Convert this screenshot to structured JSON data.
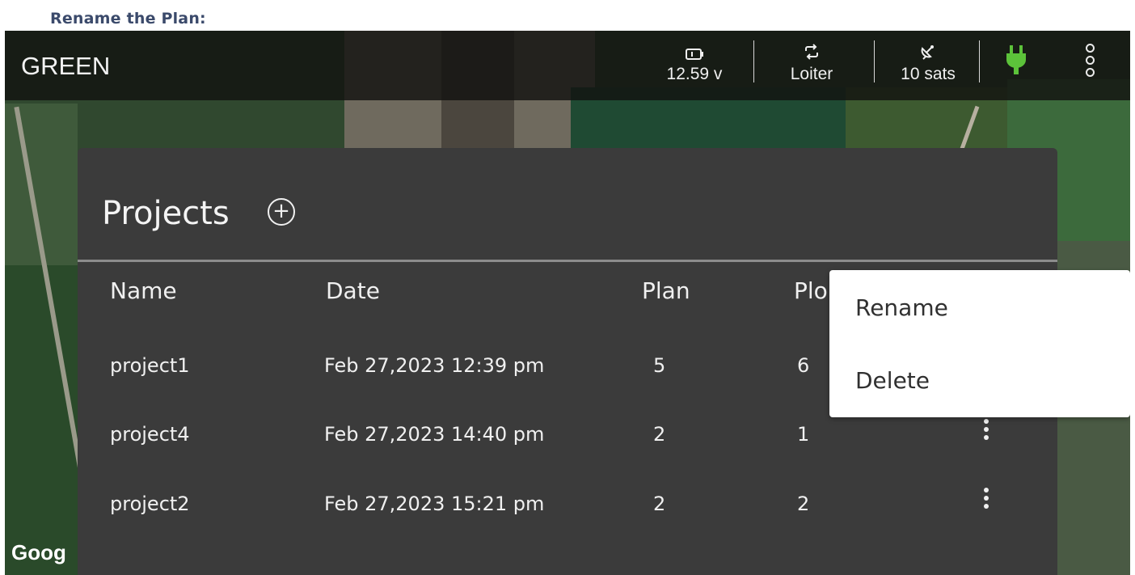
{
  "caption": "Rename the Plan:",
  "app": {
    "title": "GREEN",
    "status": {
      "battery_icon": "battery-icon",
      "battery_value": "12.59 v",
      "mode_icon": "repeat-icon",
      "mode_value": "Loiter",
      "gps_icon": "satellite-dish-icon",
      "gps_value": "10 sats",
      "plug_icon": "power-plug-icon",
      "plug_color": "#5cc23a",
      "more_icon": "more-vertical-icon"
    }
  },
  "projects": {
    "title": "Projects",
    "add_icon": "add-circle-icon",
    "columns": [
      "Name",
      "Date",
      "Plan",
      "Plo"
    ],
    "rows": [
      {
        "name": "project1",
        "date": "Feb 27,2023 12:39 pm",
        "plan": "5",
        "plot": "6"
      },
      {
        "name": "project4",
        "date": "Feb 27,2023 14:40 pm",
        "plan": "2",
        "plot": "1"
      },
      {
        "name": "project2",
        "date": "Feb 27,2023 15:21 pm",
        "plan": "2",
        "plot": "2"
      }
    ]
  },
  "context_menu": {
    "items": [
      "Rename",
      "Delete"
    ]
  },
  "map": {
    "attribution": "Goog"
  }
}
